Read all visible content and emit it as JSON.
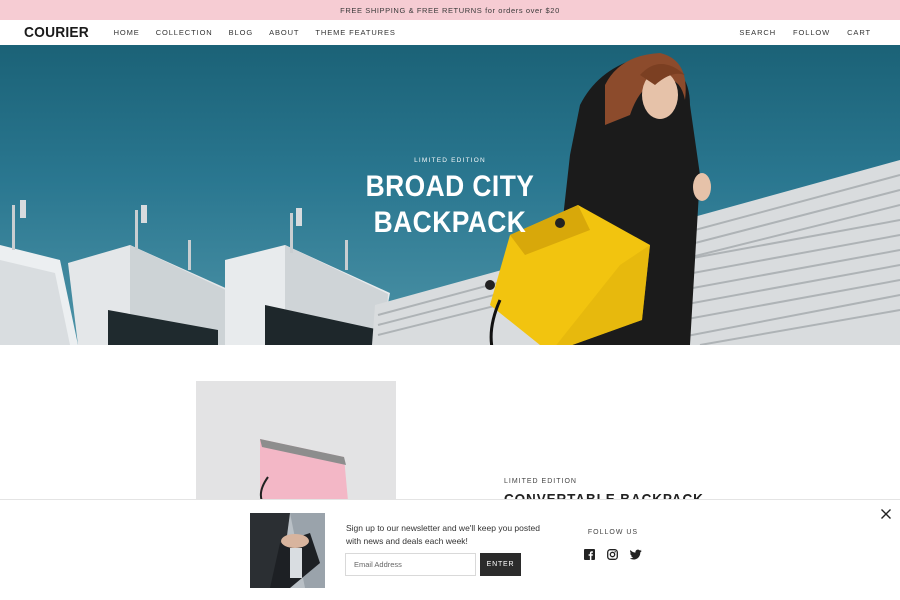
{
  "announcement": {
    "text": "FREE SHIPPING & FREE RETURNS for orders over $20"
  },
  "header": {
    "logo": "COURIER",
    "nav": [
      "HOME",
      "COLLECTION",
      "BLOG",
      "ABOUT",
      "THEME FEATURES"
    ],
    "nav_right": [
      "SEARCH",
      "FOLLOW",
      "CART"
    ]
  },
  "hero": {
    "eyebrow": "LIMITED EDITION",
    "title_line1": "BROAD CITY",
    "title_line2": "BACKPACK"
  },
  "product": {
    "eyebrow": "LIMITED EDITION",
    "title": "CONVERTABLE BACKPACK"
  },
  "newsletter": {
    "text": "Sign up to our newsletter and we'll keep you posted with news and deals each week!",
    "input_placeholder": "Email Address",
    "button_label": "ENTER",
    "follow_label": "FOLLOW US",
    "social_icons": [
      "facebook-icon",
      "instagram-icon",
      "twitter-icon"
    ]
  },
  "colors": {
    "announcement_bg": "#f6ccd3",
    "sky": "#2a7790",
    "bag_yellow": "#f2c40f",
    "product_pink": "#f3b7c6",
    "button_dark": "#2b2b2b"
  }
}
